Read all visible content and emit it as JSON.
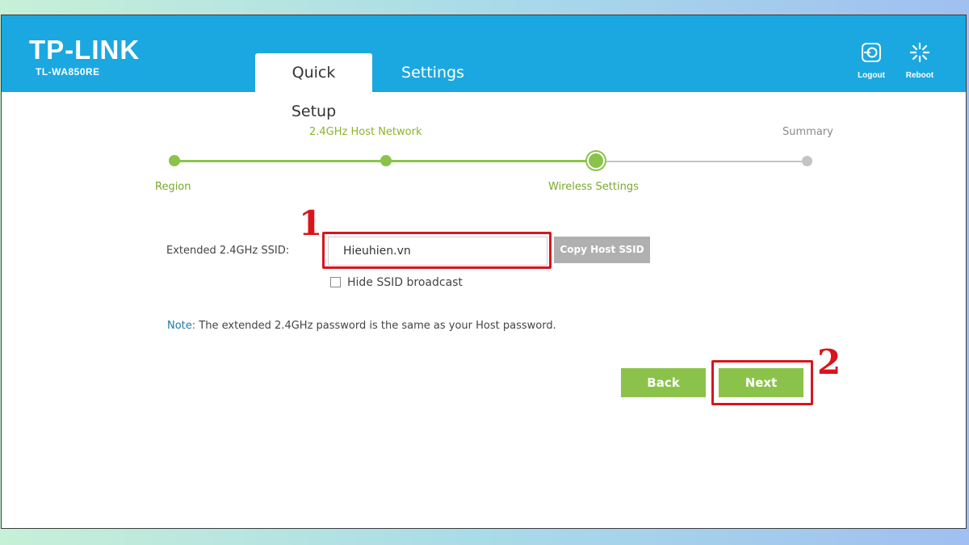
{
  "brand": {
    "logo": "TP-LINK",
    "model": "TL-WA850RE"
  },
  "tabs": [
    {
      "label": "Quick Setup",
      "active": true
    },
    {
      "label": "Settings",
      "active": false
    }
  ],
  "header_actions": [
    {
      "label": "Logout",
      "icon": "logout-icon"
    },
    {
      "label": "Reboot",
      "icon": "reboot-icon"
    }
  ],
  "progress": {
    "steps": [
      {
        "label": "Region",
        "state": "done"
      },
      {
        "label": "2.4GHz Host Network",
        "state": "done"
      },
      {
        "label": "Wireless Settings",
        "state": "current"
      },
      {
        "label": "Summary",
        "state": "pending"
      }
    ]
  },
  "form": {
    "ssid_label": "Extended 2.4GHz SSID:",
    "ssid_value": "Hieuhien.vn",
    "copy_button": "Copy Host SSID",
    "hide_ssid_label": "Hide SSID broadcast",
    "hide_ssid_checked": false
  },
  "note": {
    "key": "Note:",
    "text": "The extended 2.4GHz password is the same as your Host password."
  },
  "buttons": {
    "back": "Back",
    "next": "Next"
  },
  "annotations": {
    "step1": "1",
    "step2": "2"
  },
  "colors": {
    "header": "#1ba8e0",
    "accent_green": "#8bc34a",
    "highlight_red": "#d8151c",
    "note_blue": "#1c7ba6"
  }
}
